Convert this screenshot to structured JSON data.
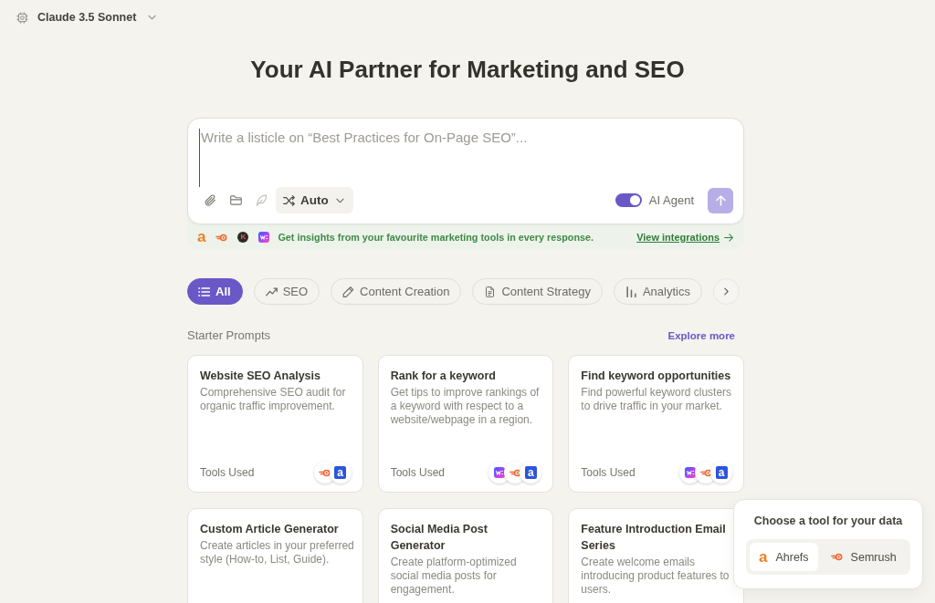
{
  "model_selector": {
    "label": "Claude 3.5 Sonnet"
  },
  "heading": "Your AI Partner for Marketing and SEO",
  "composer": {
    "placeholder": "Write a listicle on “Best Practices for On-Page SEO”...",
    "tools": [
      {
        "kind": "attach",
        "disabled": false
      },
      {
        "kind": "folder",
        "disabled": false
      },
      {
        "kind": "feather",
        "disabled": true
      }
    ],
    "mode": {
      "label": "Auto"
    },
    "ai_agent": {
      "label": "AI Agent",
      "on": true
    },
    "send": {
      "disabled": true
    }
  },
  "integrations_bar": {
    "logos": [
      {
        "kind": "letter",
        "letter": "a"
      },
      {
        "kind": "swirl"
      },
      {
        "kind": "disc",
        "letter": "K"
      },
      {
        "kind": "tile"
      }
    ],
    "text": "Get insights from your favourite marketing tools in every response.",
    "link": "View integrations"
  },
  "filters": [
    {
      "label": "All",
      "kind": "list",
      "selected": true
    },
    {
      "label": "SEO",
      "kind": "trend",
      "selected": false
    },
    {
      "label": "Content Creation",
      "kind": "pencil",
      "selected": false
    },
    {
      "label": "Content Strategy",
      "kind": "document",
      "selected": false
    },
    {
      "label": "Analytics",
      "kind": "bars",
      "selected": false
    }
  ],
  "starter_prompts": {
    "title": "Starter Prompts",
    "link": "Explore more",
    "cards": [
      {
        "title": "Website SEO Analysis",
        "description": "Comprehensive SEO audit for organic traffic improvement.",
        "tools_label": "Tools Used",
        "tools": [
          {
            "kind": "swirl"
          },
          {
            "kind": "letter-tile",
            "letter": "a"
          }
        ]
      },
      {
        "title": "Rank for a keyword",
        "description": "Get tips to improve rankings of a keyword with respect to a website/webpage in a region.",
        "tools_label": "Tools Used",
        "tools": [
          {
            "kind": "tile"
          },
          {
            "kind": "swirl"
          },
          {
            "kind": "letter-tile",
            "letter": "a"
          }
        ]
      },
      {
        "title": "Find keyword opportunities",
        "description": "Find powerful keyword clusters to drive traffic in your market.",
        "tools_label": "Tools Used",
        "tools": [
          {
            "kind": "tile"
          },
          {
            "kind": "swirl"
          },
          {
            "kind": "letter-tile",
            "letter": "a"
          }
        ]
      },
      {
        "title": "Custom Article Generator",
        "description": "Create articles in your preferred style (How-to, List, Guide)."
      },
      {
        "title": "Social Media Post Generator",
        "description": "Create platform-optimized social media posts for engagement."
      },
      {
        "title": "Feature Introduction Email Series",
        "description": "Create welcome emails introducing product features to users."
      }
    ]
  },
  "tool_picker": {
    "title": "Choose a tool for your data",
    "options": [
      {
        "label": "Ahrefs",
        "logo": {
          "kind": "letter",
          "letter": "a"
        },
        "selected": true
      },
      {
        "label": "Semrush",
        "logo": {
          "kind": "swirl"
        },
        "selected": false
      }
    ]
  }
}
